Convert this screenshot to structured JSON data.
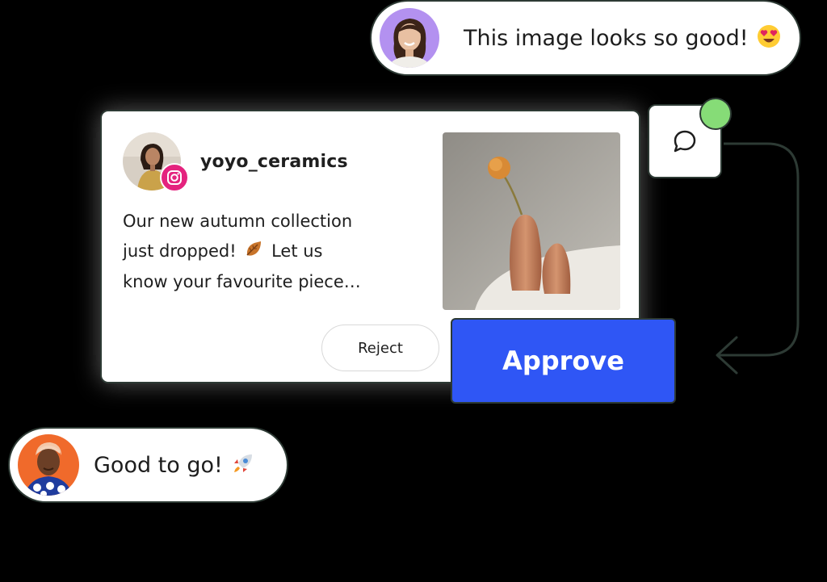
{
  "top_comment": {
    "text": "This image looks so good!",
    "emoji_icon": "heart-eyes-emoji"
  },
  "post": {
    "username": "yoyo_ceramics",
    "platform_icon": "instagram-icon",
    "caption_lines": [
      "Our new autumn collection",
      "just dropped!",
      "Let us",
      "know your favourite piece…"
    ],
    "reject_label": "Reject",
    "approve_label": "Approve"
  },
  "bottom_comment": {
    "text": "Good to go!",
    "emoji_icon": "rocket-emoji"
  },
  "colors": {
    "approve": "#2f56f5",
    "instagram_badge": "#e4237e",
    "notification_dot": "#86dc77",
    "border": "#2d3a34"
  }
}
